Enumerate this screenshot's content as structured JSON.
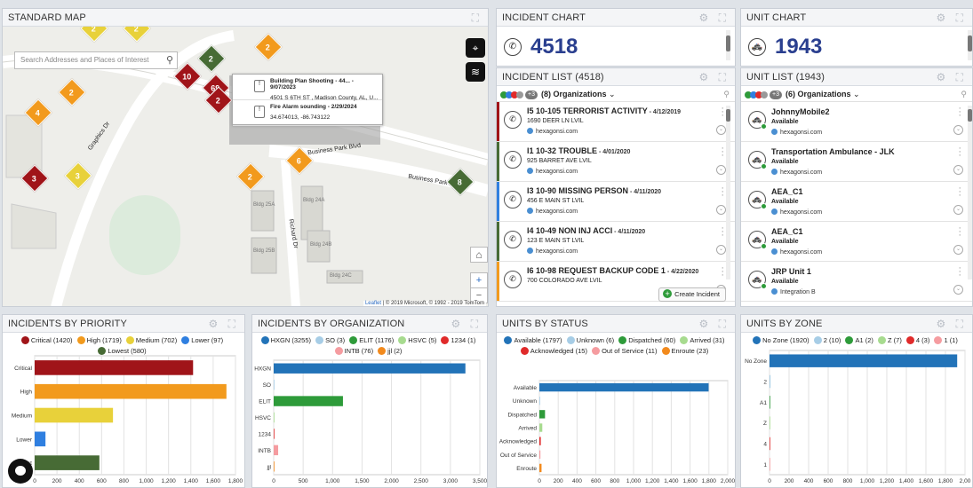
{
  "map": {
    "title": "STANDARD MAP",
    "search_placeholder": "Search Addresses and Places of Interest",
    "popup": [
      {
        "title": "Building Plan Shooting - 44... - 9/07/2023",
        "sub": "4501 S 6TH ST , Madison County, AL, U..."
      },
      {
        "title": "Fire Alarm sounding - 2/29/2024",
        "sub": "34.674013, -86.743122"
      }
    ],
    "streets": [
      "Business Park Blvd",
      "Business Park B",
      "Graphics Dr",
      "Richard Dr"
    ],
    "buildings": [
      "Bldg 24A",
      "Bldg 24B",
      "Bldg 25A",
      "Bldg 25B",
      "Bldg 24C"
    ],
    "attrib_link": "Leaflet",
    "attrib": "| © 2019 Microsoft, © 1992 - 2019 TomTom",
    "clusters": [
      {
        "n": "2",
        "c": "#f29a1d"
      },
      {
        "n": "2",
        "c": "#476b35"
      },
      {
        "n": "10",
        "c": "#a01419"
      },
      {
        "n": "69",
        "c": "#a01419"
      },
      {
        "n": "2",
        "c": "#a01419"
      },
      {
        "n": "2",
        "c": "#f29a1d"
      },
      {
        "n": "4",
        "c": "#f29a1d"
      },
      {
        "n": "2",
        "c": "#e8d13a"
      },
      {
        "n": "3",
        "c": "#a01419"
      },
      {
        "n": "3",
        "c": "#e8d13a"
      },
      {
        "n": "2",
        "c": "#f29a1d"
      },
      {
        "n": "6",
        "c": "#f29a1d"
      },
      {
        "n": "8",
        "c": "#476b35"
      },
      {
        "n": "2",
        "c": "#e8d13a"
      }
    ]
  },
  "incident_chart": {
    "title": "INCIDENT CHART",
    "count": "4518"
  },
  "unit_chart": {
    "title": "UNIT CHART",
    "count": "1943"
  },
  "incident_list": {
    "title": "INCIDENT LIST (4518)",
    "org_count": "+3",
    "orgs": "(8) Organizations",
    "create": "Create Incident",
    "items": [
      {
        "code": "I5 10-105 TERRORIST ACTIVITY",
        "date": " - 4/12/2019",
        "addr": "1690 DEER LN LVIL",
        "org": "hexagonsi.com",
        "color": "#a01419"
      },
      {
        "code": "I1 10-32 TROUBLE",
        "date": " - 4/01/2020",
        "addr": "925 BARRET AVE LVIL",
        "org": "hexagonsi.com",
        "color": "#476b35"
      },
      {
        "code": "I3 10-90 MISSING PERSON",
        "date": " - 4/11/2020",
        "addr": "456 E MAIN ST LVIL",
        "org": "hexagonsi.com",
        "color": "#2f7fe0"
      },
      {
        "code": "I4 10-49 NON INJ ACCI",
        "date": " - 4/11/2020",
        "addr": "123 E MAIN ST LVIL",
        "org": "hexagonsi.com",
        "color": "#476b35"
      },
      {
        "code": "I6 10-98 REQUEST BACKUP CODE 1",
        "date": " - 4/22/2020",
        "addr": "700 COLORADO AVE LVIL",
        "org": "",
        "color": "#f29a1d"
      }
    ]
  },
  "unit_list": {
    "title": "UNIT LIST (1943)",
    "org_count": "+3",
    "orgs": "(6) Organizations",
    "items": [
      {
        "name": "JohnnyMobile2",
        "status": "Available",
        "org": "hexagonsi.com"
      },
      {
        "name": "Transportation Ambulance - JLK",
        "status": "Available",
        "org": "hexagonsi.com"
      },
      {
        "name": "AEA_C1",
        "status": "Available",
        "org": "hexagonsi.com"
      },
      {
        "name": "AEA_C1",
        "status": "Available",
        "org": "hexagonsi.com"
      },
      {
        "name": "JRP Unit 1",
        "status": "Available",
        "org": "Integration B"
      }
    ]
  },
  "colors": {
    "critical": "#a01419",
    "high": "#f29a1d",
    "medium": "#e8d13a",
    "lower": "#2f7fe0",
    "lowest": "#476b35",
    "accent": "#2a3f8f"
  },
  "chart_data": [
    {
      "type": "bar",
      "title": "INCIDENTS BY PRIORITY",
      "orientation": "horizontal",
      "legend": [
        "Critical (1420)",
        "High (1719)",
        "Medium (702)",
        "Lower (97)",
        "Lowest (580)"
      ],
      "categories": [
        "Critical",
        "High",
        "Medium",
        "Lower",
        "Lowest"
      ],
      "values": [
        1420,
        1719,
        702,
        97,
        580
      ],
      "colors": [
        "#a01419",
        "#f29a1d",
        "#e8d13a",
        "#2f7fe0",
        "#476b35"
      ],
      "xlim": [
        0,
        1800
      ],
      "ticks": [
        0,
        200,
        400,
        600,
        800,
        1000,
        1200,
        1400,
        1600,
        1800
      ],
      "ticklabels": [
        "0",
        "200",
        "400",
        "600",
        "800",
        "1,000",
        "1,200",
        "1,400",
        "1,600",
        "1,800"
      ],
      "grid": true
    },
    {
      "type": "bar",
      "title": "INCIDENTS BY ORGANIZATION",
      "orientation": "horizontal",
      "legend": [
        "HXGN (3255)",
        "SO (3)",
        "ELIT (1176)",
        "HSVC (5)",
        "1234 (1)",
        "INTB (76)",
        "jjl (2)"
      ],
      "categories": [
        "HXGN",
        "SO",
        "ELIT",
        "HSVC",
        "1234",
        "INTB",
        "jjl"
      ],
      "values": [
        3255,
        3,
        1176,
        5,
        1,
        76,
        2
      ],
      "colors": [
        "#2273b8",
        "#a7cde6",
        "#2e9b3a",
        "#a7db8f",
        "#e02a2a",
        "#f59ca0",
        "#f28a1d"
      ],
      "xlim": [
        0,
        3500
      ],
      "ticks": [
        0,
        500,
        1000,
        1500,
        2000,
        2500,
        3000,
        3500
      ],
      "ticklabels": [
        "0",
        "500",
        "1,000",
        "1,500",
        "2,000",
        "2,500",
        "3,000",
        "3,500"
      ],
      "grid": true
    },
    {
      "type": "bar",
      "title": "UNITS BY STATUS",
      "orientation": "horizontal",
      "legend": [
        "Available (1797)",
        "Unknown (6)",
        "Dispatched (60)",
        "Arrived (31)",
        "Acknowledged (15)",
        "Out of Service (11)",
        "Enroute (23)"
      ],
      "categories": [
        "Available",
        "Unknown",
        "Dispatched",
        "Arrived",
        "Acknowledged",
        "Out of Service",
        "Enroute"
      ],
      "values": [
        1797,
        6,
        60,
        31,
        15,
        11,
        23
      ],
      "colors": [
        "#2273b8",
        "#a7cde6",
        "#2e9b3a",
        "#a7db8f",
        "#e02a2a",
        "#f59ca0",
        "#f28a1d"
      ],
      "xlim": [
        0,
        2000
      ],
      "ticks": [
        0,
        200,
        400,
        600,
        800,
        1000,
        1200,
        1400,
        1600,
        1800,
        2000
      ],
      "ticklabels": [
        "0",
        "200",
        "400",
        "600",
        "800",
        "1,000",
        "1,200",
        "1,400",
        "1,600",
        "1,800",
        "2,000"
      ],
      "grid": true
    },
    {
      "type": "bar",
      "title": "UNITS BY ZONE",
      "orientation": "horizontal",
      "legend": [
        "No Zone (1920)",
        "2 (10)",
        "A1 (2)",
        "Z (7)",
        "4 (3)",
        "1 (1)"
      ],
      "categories": [
        "No Zone",
        "2",
        "A1",
        "Z",
        "4",
        "1"
      ],
      "values": [
        1920,
        10,
        2,
        7,
        3,
        1
      ],
      "colors": [
        "#2273b8",
        "#a7cde6",
        "#2e9b3a",
        "#a7db8f",
        "#e02a2a",
        "#f59ca0"
      ],
      "xlim": [
        0,
        2000
      ],
      "ticks": [
        0,
        200,
        400,
        600,
        800,
        1000,
        1200,
        1400,
        1600,
        1800,
        2000
      ],
      "ticklabels": [
        "0",
        "200",
        "400",
        "600",
        "800",
        "1,000",
        "1,200",
        "1,400",
        "1,600",
        "1,800",
        "2,00"
      ],
      "grid": true
    }
  ]
}
